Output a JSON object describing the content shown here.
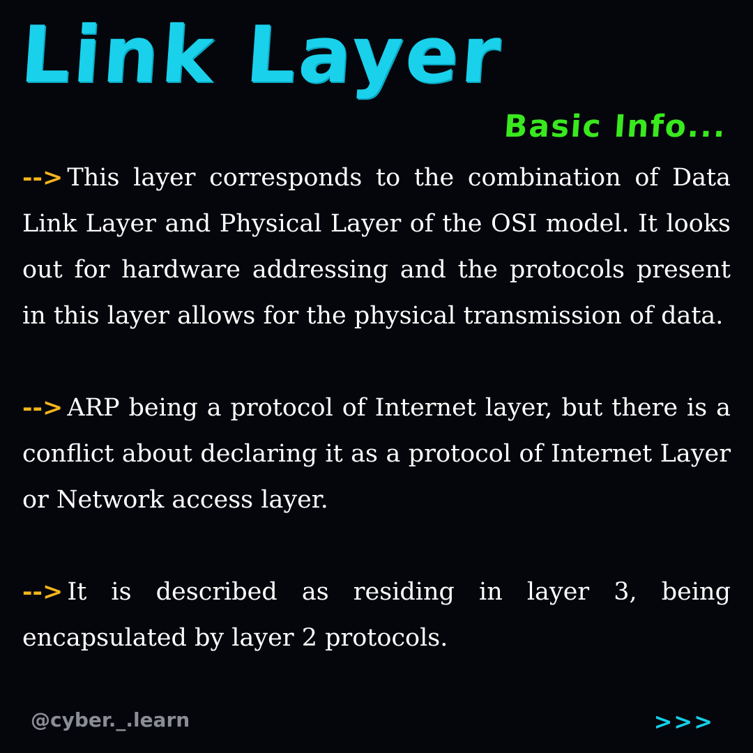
{
  "header": {
    "title": "Link Layer",
    "subtitle": "Basic Info..."
  },
  "paragraphs": [
    {
      "marker": "-->",
      "text": "This layer corresponds to the combination of Data Link Layer and Physical Layer of the OSI model. It looks out for hardware addressing and the protocols present in this layer allows for the physical transmission of data."
    },
    {
      "marker": "-->",
      "text": "ARP being a protocol of Internet layer, but there is a conflict about declaring it as a protocol of Internet Layer or Network access layer."
    },
    {
      "marker": "-->",
      "text": "It is described as residing in layer 3, being encapsulated by layer 2 protocols."
    }
  ],
  "footer": {
    "handle": "@cyber._.learn",
    "next_label": ">>>"
  },
  "colors": {
    "background": "#05060c",
    "title": "#1ad1ec",
    "subtitle": "#39e91e",
    "arrow": "#f3b51b",
    "body_text": "#ffffff",
    "handle": "#8b8d94",
    "next": "#15cfe9"
  }
}
